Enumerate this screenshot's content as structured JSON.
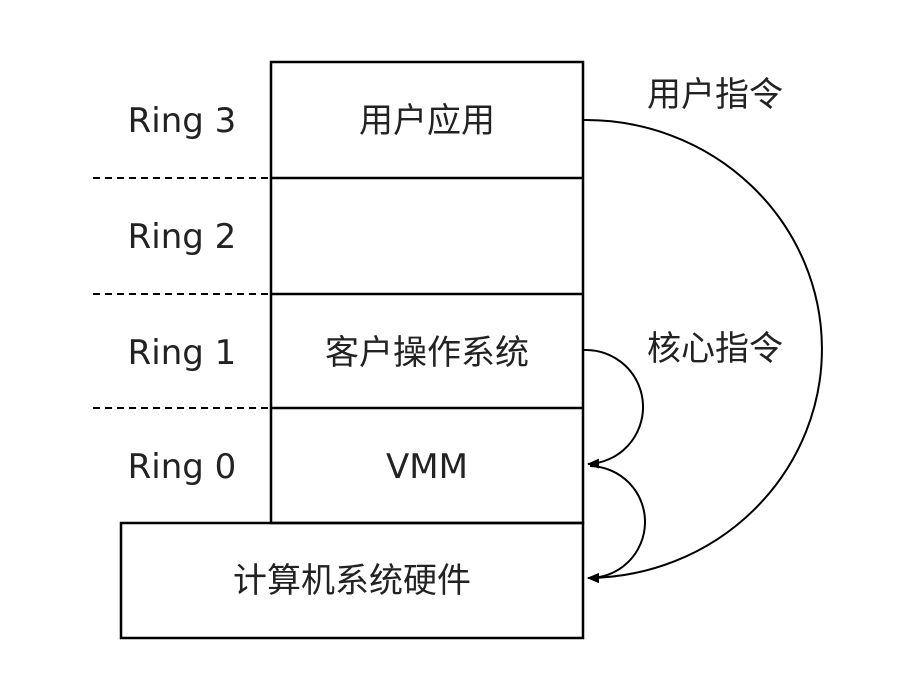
{
  "rings": [
    {
      "label": "Ring 3",
      "content": "用户应用"
    },
    {
      "label": "Ring 2",
      "content": ""
    },
    {
      "label": "Ring 1",
      "content": "客户操作系统"
    },
    {
      "label": "Ring 0",
      "content": "VMM"
    }
  ],
  "hardware": "计算机系统硬件",
  "arrows": {
    "user_instructions": "用户指令",
    "kernel_instructions": "核心指令"
  }
}
